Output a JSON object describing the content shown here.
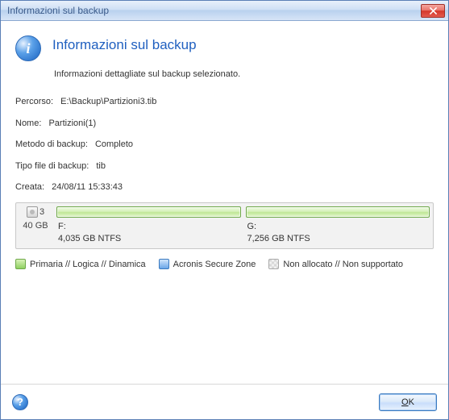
{
  "titlebar": {
    "text": "Informazioni sul backup"
  },
  "header": {
    "heading": "Informazioni sul backup",
    "subheading": "Informazioni dettagliate sul backup selezionato."
  },
  "details": {
    "path_label": "Percorso:",
    "path_value": "E:\\Backup\\Partizioni3.tib",
    "name_label": "Nome:",
    "name_value": "Partizioni(1)",
    "method_label": "Metodo di backup:",
    "method_value": "Completo",
    "type_label": "Tipo file di backup:",
    "type_value": "tib",
    "created_label": "Creata:",
    "created_value": "24/08/11 15:33:43"
  },
  "disk": {
    "number": "3",
    "capacity": "40 GB",
    "partitions": [
      {
        "letter": "F:",
        "size_fs": "4,035 GB  NTFS"
      },
      {
        "letter": "G:",
        "size_fs": "7,256 GB  NTFS"
      }
    ]
  },
  "legend": {
    "primary": "Primaria // Logica // Dinamica",
    "asz": "Acronis Secure Zone",
    "unalloc": "Non allocato // Non supportato"
  },
  "footer": {
    "ok_prefix": "O",
    "ok_suffix": "K"
  }
}
